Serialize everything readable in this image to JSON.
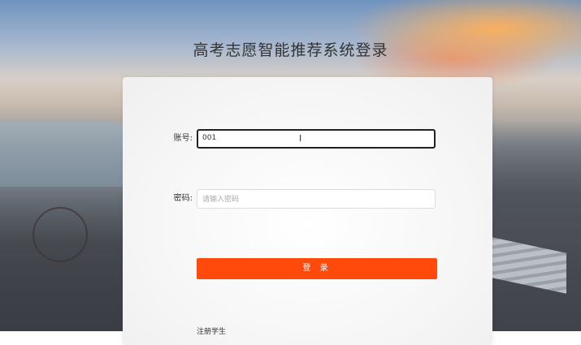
{
  "page": {
    "title": "高考志愿智能推荐系统登录"
  },
  "form": {
    "account_label": "账号:",
    "account_value": "001",
    "password_label": "密码:",
    "password_placeholder": "请输入密码",
    "login_button": "登 录",
    "register_link": "注册学生"
  },
  "colors": {
    "primary_button": "#ff4a0c",
    "card_bg": "#f7f7f7",
    "focus_border": "#222222"
  }
}
